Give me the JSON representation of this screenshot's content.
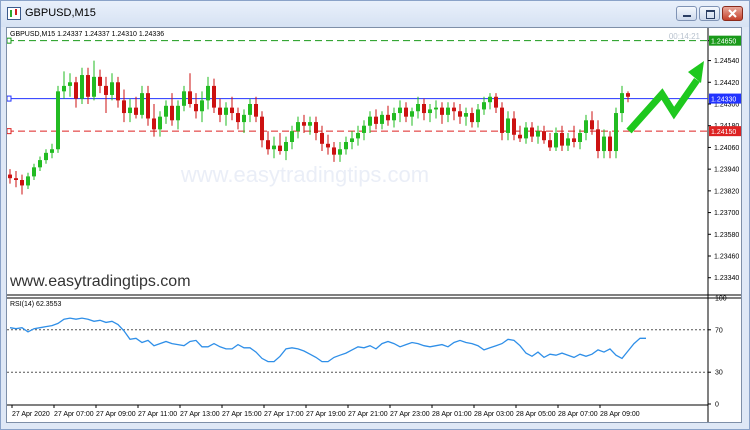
{
  "window": {
    "title": "GBPUSD,M15",
    "buttons": [
      "minimize",
      "restore",
      "close"
    ]
  },
  "header": {
    "symbol_info": "GBPUSD,M15  1.24337 1.24337 1.24310 1.24336",
    "countdown": "00:14:21"
  },
  "watermarks": {
    "center": "www.easytradingtips.com",
    "bottom_left": "www.easytradingtips.com"
  },
  "colors": {
    "bull": "#22bb22",
    "bear": "#cc1111",
    "blue_line": "#2233ff",
    "green_line": "#1a9a1a",
    "red_line": "#dd2222",
    "rsi_line": "#2f8fe8",
    "arrow": "#1ec81e",
    "countdown": "#b9c3cf"
  },
  "chart_data": [
    {
      "type": "candlestick",
      "title": "GBPUSD,M15",
      "ylim": [
        1.2325,
        1.2472
      ],
      "y_ticks": [
        "1.24650",
        "1.24540",
        "1.24420",
        "1.24300",
        "1.24180",
        "1.24060",
        "1.23940",
        "1.23820",
        "1.23700",
        "1.23580",
        "1.23460",
        "1.23340"
      ],
      "price_lines": [
        {
          "name": "green",
          "value": 1.2465,
          "label": "1.24650",
          "color": "#1a9a1a",
          "style": "dashed"
        },
        {
          "name": "blue",
          "value": 1.2433,
          "label": "1.24330",
          "color": "#2233ff",
          "style": "solid"
        },
        {
          "name": "red",
          "value": 1.2415,
          "label": "1.24150",
          "color": "#dd2222",
          "style": "dashed"
        }
      ],
      "candles": [
        [
          1.2391,
          1.2394,
          1.2386,
          1.2389
        ],
        [
          1.2389,
          1.2393,
          1.2384,
          1.2388
        ],
        [
          1.2388,
          1.2391,
          1.238,
          1.2385
        ],
        [
          1.2385,
          1.2392,
          1.2383,
          1.239
        ],
        [
          1.239,
          1.2397,
          1.2388,
          1.2395
        ],
        [
          1.2395,
          1.2401,
          1.2393,
          1.2399
        ],
        [
          1.2399,
          1.2405,
          1.2397,
          1.2403
        ],
        [
          1.2403,
          1.2408,
          1.24,
          1.2405
        ],
        [
          1.2405,
          1.244,
          1.2403,
          1.2437
        ],
        [
          1.2437,
          1.2448,
          1.2433,
          1.244
        ],
        [
          1.244,
          1.2447,
          1.2434,
          1.2442
        ],
        [
          1.2442,
          1.2445,
          1.2428,
          1.2433
        ],
        [
          1.2433,
          1.245,
          1.243,
          1.2446
        ],
        [
          1.2446,
          1.245,
          1.243,
          1.2434
        ],
        [
          1.2434,
          1.2454,
          1.2432,
          1.2445
        ],
        [
          1.2445,
          1.2449,
          1.2436,
          1.244
        ],
        [
          1.244,
          1.2445,
          1.2425,
          1.2435
        ],
        [
          1.2435,
          1.2447,
          1.2432,
          1.2442
        ],
        [
          1.2442,
          1.2445,
          1.2428,
          1.2432
        ],
        [
          1.2432,
          1.2438,
          1.242,
          1.2425
        ],
        [
          1.2425,
          1.2433,
          1.242,
          1.2428
        ],
        [
          1.2428,
          1.2434,
          1.2422,
          1.2424
        ],
        [
          1.2424,
          1.244,
          1.2422,
          1.2436
        ],
        [
          1.2436,
          1.244,
          1.2418,
          1.2422
        ],
        [
          1.2422,
          1.243,
          1.2412,
          1.2416
        ],
        [
          1.2416,
          1.2426,
          1.2412,
          1.2423
        ],
        [
          1.2423,
          1.2432,
          1.2419,
          1.2429
        ],
        [
          1.2429,
          1.2436,
          1.2418,
          1.2421
        ],
        [
          1.2421,
          1.2432,
          1.2416,
          1.2429
        ],
        [
          1.2429,
          1.244,
          1.2426,
          1.2437
        ],
        [
          1.2437,
          1.2447,
          1.2428,
          1.243
        ],
        [
          1.243,
          1.2436,
          1.2422,
          1.2426
        ],
        [
          1.2426,
          1.2437,
          1.242,
          1.2432
        ],
        [
          1.2432,
          1.2445,
          1.2427,
          1.244
        ],
        [
          1.244,
          1.2444,
          1.2425,
          1.2428
        ],
        [
          1.2428,
          1.2433,
          1.242,
          1.2424
        ],
        [
          1.2424,
          1.2431,
          1.2418,
          1.2428
        ],
        [
          1.2428,
          1.2434,
          1.2421,
          1.2425
        ],
        [
          1.2425,
          1.2428,
          1.2416,
          1.242
        ],
        [
          1.242,
          1.2427,
          1.2414,
          1.2424
        ],
        [
          1.2424,
          1.2433,
          1.242,
          1.243
        ],
        [
          1.243,
          1.2434,
          1.242,
          1.2423
        ],
        [
          1.2423,
          1.2426,
          1.2406,
          1.241
        ],
        [
          1.241,
          1.2415,
          1.2402,
          1.2405
        ],
        [
          1.2405,
          1.2412,
          1.24,
          1.2407
        ],
        [
          1.2407,
          1.2414,
          1.2402,
          1.2404
        ],
        [
          1.2404,
          1.2412,
          1.2399,
          1.2409
        ],
        [
          1.2409,
          1.2418,
          1.2405,
          1.2415
        ],
        [
          1.2415,
          1.2423,
          1.2411,
          1.242
        ],
        [
          1.242,
          1.2424,
          1.2414,
          1.2418
        ],
        [
          1.2418,
          1.2423,
          1.2413,
          1.242
        ],
        [
          1.242,
          1.2423,
          1.241,
          1.2414
        ],
        [
          1.2414,
          1.2418,
          1.2404,
          1.2408
        ],
        [
          1.2408,
          1.2413,
          1.2402,
          1.2406
        ],
        [
          1.2406,
          1.2409,
          1.2398,
          1.2402
        ],
        [
          1.2402,
          1.2409,
          1.2398,
          1.2405
        ],
        [
          1.2405,
          1.2412,
          1.2402,
          1.2409
        ],
        [
          1.2409,
          1.2415,
          1.2405,
          1.2411
        ],
        [
          1.2411,
          1.2418,
          1.2407,
          1.2414
        ],
        [
          1.2414,
          1.2421,
          1.241,
          1.2418
        ],
        [
          1.2418,
          1.2426,
          1.2414,
          1.2423
        ],
        [
          1.2423,
          1.2427,
          1.2416,
          1.2419
        ],
        [
          1.2419,
          1.2426,
          1.2416,
          1.2424
        ],
        [
          1.2424,
          1.2429,
          1.2418,
          1.2421
        ],
        [
          1.2421,
          1.2428,
          1.2417,
          1.2425
        ],
        [
          1.2425,
          1.2432,
          1.242,
          1.2428
        ],
        [
          1.2428,
          1.2431,
          1.242,
          1.2423
        ],
        [
          1.2423,
          1.2428,
          1.2418,
          1.2426
        ],
        [
          1.2426,
          1.2434,
          1.2422,
          1.243
        ],
        [
          1.243,
          1.2433,
          1.2421,
          1.2425
        ],
        [
          1.2425,
          1.243,
          1.242,
          1.2427
        ],
        [
          1.2427,
          1.2432,
          1.2422,
          1.2428
        ],
        [
          1.2428,
          1.2431,
          1.2419,
          1.2424
        ],
        [
          1.2424,
          1.2431,
          1.242,
          1.2428
        ],
        [
          1.2428,
          1.2431,
          1.2421,
          1.2426
        ],
        [
          1.2426,
          1.243,
          1.2419,
          1.2423
        ],
        [
          1.2423,
          1.2428,
          1.2418,
          1.2425
        ],
        [
          1.2425,
          1.2428,
          1.2417,
          1.242
        ],
        [
          1.242,
          1.243,
          1.2417,
          1.2427
        ],
        [
          1.2427,
          1.2434,
          1.2424,
          1.2431
        ],
        [
          1.2431,
          1.2436,
          1.2427,
          1.2434
        ],
        [
          1.2434,
          1.2436,
          1.2425,
          1.2428
        ],
        [
          1.2428,
          1.2431,
          1.241,
          1.2414
        ],
        [
          1.2414,
          1.2426,
          1.241,
          1.2422
        ],
        [
          1.2422,
          1.2426,
          1.241,
          1.2413
        ],
        [
          1.2413,
          1.2418,
          1.2409,
          1.2411
        ],
        [
          1.2411,
          1.242,
          1.2408,
          1.2417
        ],
        [
          1.2417,
          1.242,
          1.2409,
          1.2412
        ],
        [
          1.2412,
          1.2418,
          1.2408,
          1.2415
        ],
        [
          1.2415,
          1.2418,
          1.2408,
          1.241
        ],
        [
          1.241,
          1.2414,
          1.2404,
          1.2406
        ],
        [
          1.2406,
          1.2417,
          1.2404,
          1.2414
        ],
        [
          1.2414,
          1.2418,
          1.2404,
          1.2407
        ],
        [
          1.2407,
          1.2414,
          1.2404,
          1.2411
        ],
        [
          1.2411,
          1.2418,
          1.2406,
          1.2409
        ],
        [
          1.2409,
          1.2416,
          1.2405,
          1.2414
        ],
        [
          1.2414,
          1.2424,
          1.241,
          1.2421
        ],
        [
          1.2421,
          1.2426,
          1.2413,
          1.2416
        ],
        [
          1.2416,
          1.2421,
          1.24,
          1.2404
        ],
        [
          1.2404,
          1.2416,
          1.24,
          1.2412
        ],
        [
          1.2412,
          1.2415,
          1.24,
          1.2404
        ],
        [
          1.2404,
          1.2428,
          1.24,
          1.2425
        ],
        [
          1.2425,
          1.244,
          1.242,
          1.2436
        ],
        [
          1.2436,
          1.2437,
          1.2431,
          1.2434
        ]
      ]
    },
    {
      "type": "line",
      "title": "RSI(14) 62.3553",
      "ylim": [
        0,
        100
      ],
      "y_ticks": [
        "100",
        "70",
        "30",
        "0"
      ],
      "levels": [
        70,
        30
      ],
      "series": [
        {
          "name": "RSI(14)",
          "values": [
            72,
            71,
            72,
            68,
            71,
            72,
            73,
            74,
            76,
            80,
            81,
            80,
            81,
            80,
            78,
            79,
            77,
            78,
            75,
            69,
            61,
            62,
            58,
            60,
            55,
            57,
            59,
            57,
            56,
            55,
            59,
            60,
            54,
            54,
            57,
            54,
            52,
            52,
            56,
            53,
            53,
            49,
            43,
            40,
            40,
            45,
            52,
            53,
            52,
            50,
            47,
            44,
            40,
            40,
            44,
            46,
            48,
            51,
            54,
            53,
            55,
            52,
            57,
            59,
            57,
            54,
            56,
            58,
            57,
            55,
            54,
            55,
            56,
            54,
            58,
            60,
            58,
            57,
            55,
            51,
            53,
            55,
            57,
            61,
            60,
            55,
            48,
            45,
            49,
            44,
            47,
            46,
            48,
            46,
            44,
            47,
            45,
            47,
            51,
            49,
            52,
            46,
            43,
            50,
            57,
            62,
            62
          ]
        }
      ],
      "x_ticks": [
        "27 Apr 2020",
        "27 Apr 07:00",
        "27 Apr 09:00",
        "27 Apr 11:00",
        "27 Apr 13:00",
        "27 Apr 15:00",
        "27 Apr 17:00",
        "27 Apr 19:00",
        "27 Apr 21:00",
        "27 Apr 23:00",
        "28 Apr 01:00",
        "28 Apr 03:00",
        "28 Apr 05:00",
        "28 Apr 07:00",
        "28 Apr 09:00"
      ]
    }
  ]
}
